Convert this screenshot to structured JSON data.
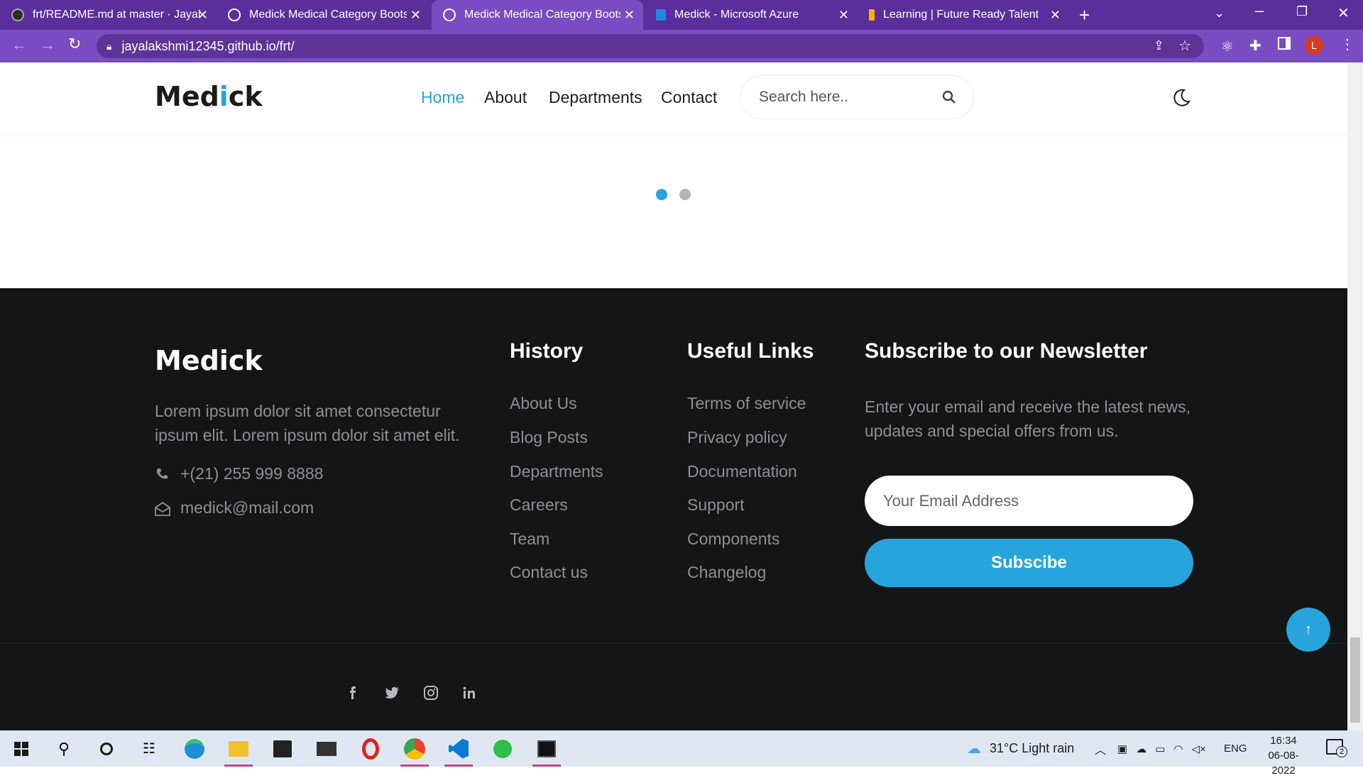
{
  "browser": {
    "tabs": [
      {
        "title": "frt/README.md at master · Jayala",
        "icon": "github-icon",
        "active": false
      },
      {
        "title": "Medick Medical Category Bootstr",
        "icon": "globe-icon",
        "active": false
      },
      {
        "title": "Medick Medical Category Bootstr",
        "icon": "globe-icon",
        "active": true
      },
      {
        "title": "Medick - Microsoft Azure",
        "icon": "azure-icon",
        "active": false
      },
      {
        "title": "Learning | Future Ready Talent",
        "icon": "learning-icon",
        "active": false
      }
    ],
    "url": "jayalakshmi12345.github.io/frt/",
    "profile_initial": "L"
  },
  "nav": {
    "brand_prefix": "Med",
    "brand_accent": "i",
    "brand_suffix": "ck",
    "links": [
      "Home",
      "About",
      "Departments",
      "Contact"
    ],
    "active_link": "Home",
    "search_placeholder": "Search here.."
  },
  "carousel": {
    "dots": 2,
    "active_dot": 0
  },
  "footer": {
    "brand": "Medick",
    "description_line1": "Lorem ipsum dolor sit amet consectetur",
    "description_line2": "ipsum elit. Lorem ipsum dolor sit amet elit.",
    "phone": "+(21) 255 999 8888",
    "email": "medick@mail.com",
    "history": {
      "heading": "History",
      "links": [
        "About Us",
        "Blog Posts",
        "Departments",
        "Careers",
        "Team",
        "Contact us"
      ]
    },
    "useful_links": {
      "heading": "Useful Links",
      "links": [
        "Terms of service",
        "Privacy policy",
        "Documentation",
        "Support",
        "Components",
        "Changelog"
      ]
    },
    "newsletter": {
      "heading": "Subscribe to our Newsletter",
      "text_line1": "Enter your email and receive the latest news,",
      "text_line2": "updates and special offers from us.",
      "email_placeholder": "Your Email Address",
      "button_label": "Subscibe"
    },
    "social": [
      "facebook-icon",
      "twitter-icon",
      "instagram-icon",
      "linkedin-icon"
    ]
  },
  "taskbar": {
    "weather": "31°C  Light rain",
    "language": "ENG",
    "time": "16:34",
    "date": "06-08-2022",
    "notification_count": "2"
  },
  "colors": {
    "accent": "#27a4db",
    "browser_purple": "#5b2f9b",
    "footer_bg": "#141517"
  }
}
